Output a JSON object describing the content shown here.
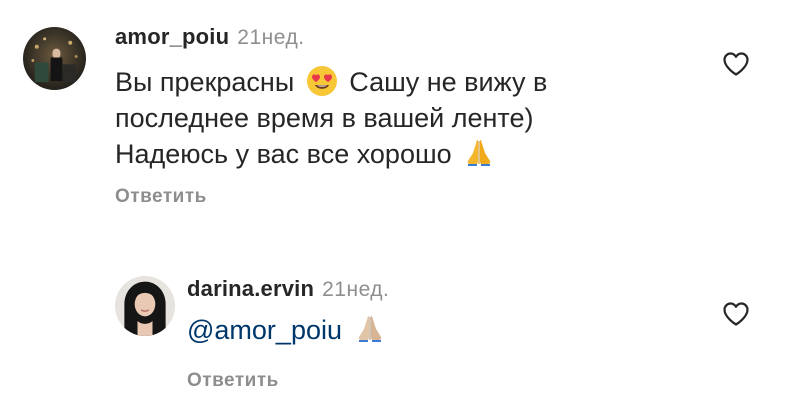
{
  "comments": [
    {
      "username": "amor_poiu",
      "time": "21нед.",
      "text_part1": "Вы прекрасны",
      "text_part2": "Сашу не вижу в",
      "line2": "последнее время в вашей ленте)",
      "line3": "Надеюсь у вас все хорошо",
      "reply_label": "Ответить",
      "emojis": [
        "heart-eyes-emoji",
        "folded-hands-emoji"
      ],
      "liked": false
    },
    {
      "username": "darina.ervin",
      "time": "21нед.",
      "mention": "@amor_poiu",
      "reply_label": "Ответить",
      "emojis": [
        "folded-hands-light-emoji"
      ],
      "liked": false
    }
  ],
  "colors": {
    "username": "#262626",
    "secondary": "#8e8e8e",
    "mention": "#00376b"
  }
}
